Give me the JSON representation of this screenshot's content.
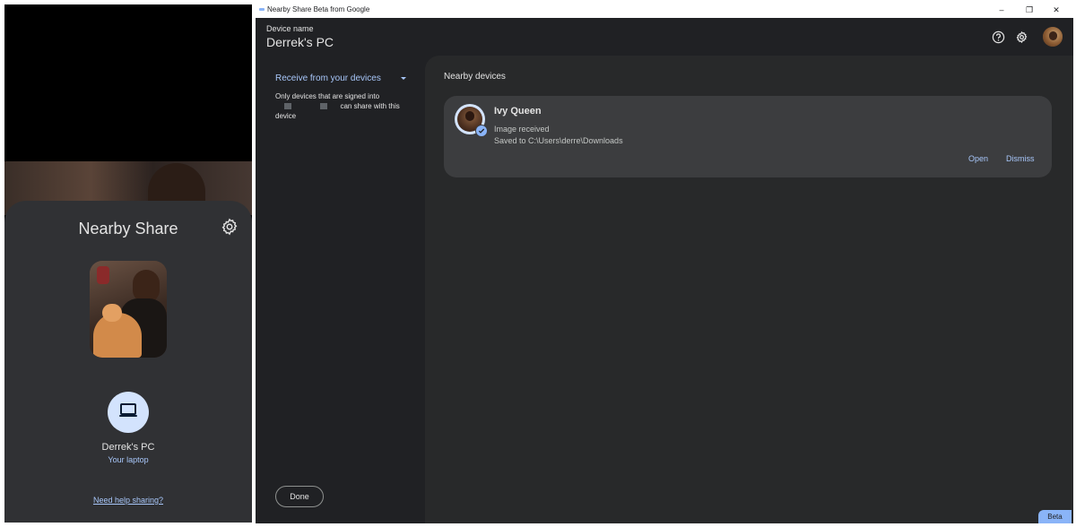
{
  "phone": {
    "sheet_title": "Nearby Share",
    "device_name": "Derrek's PC",
    "device_subtitle": "Your laptop",
    "help_link": "Need help sharing?",
    "icons": {
      "settings": "gear-icon",
      "device": "laptop-icon"
    }
  },
  "window": {
    "title": "Nearby Share Beta from Google",
    "controls": {
      "minimize": "–",
      "restore": "❐",
      "close": "✕"
    },
    "header": {
      "device_label": "Device name",
      "device_value": "Derrek's PC",
      "icons": [
        "help-icon",
        "gear-icon",
        "account-avatar"
      ]
    },
    "sidebar": {
      "receive_dropdown": "Receive from your devices",
      "receive_desc_part1": "Only devices that are signed into",
      "receive_desc_part2": "can share with this device",
      "done_label": "Done"
    },
    "main": {
      "section_title": "Nearby devices",
      "card": {
        "sender": "Ivy Queen",
        "status": "Image received",
        "saved_to": "Saved to C:\\Users\\derre\\Downloads",
        "open_label": "Open",
        "dismiss_label": "Dismiss"
      }
    },
    "beta_badge": "Beta"
  },
  "colors": {
    "accent": "#a8c7fa",
    "window_bg": "#202124",
    "pane_bg": "#28292a",
    "card_bg": "#3c3d3f",
    "sheet_bg": "#303134"
  }
}
